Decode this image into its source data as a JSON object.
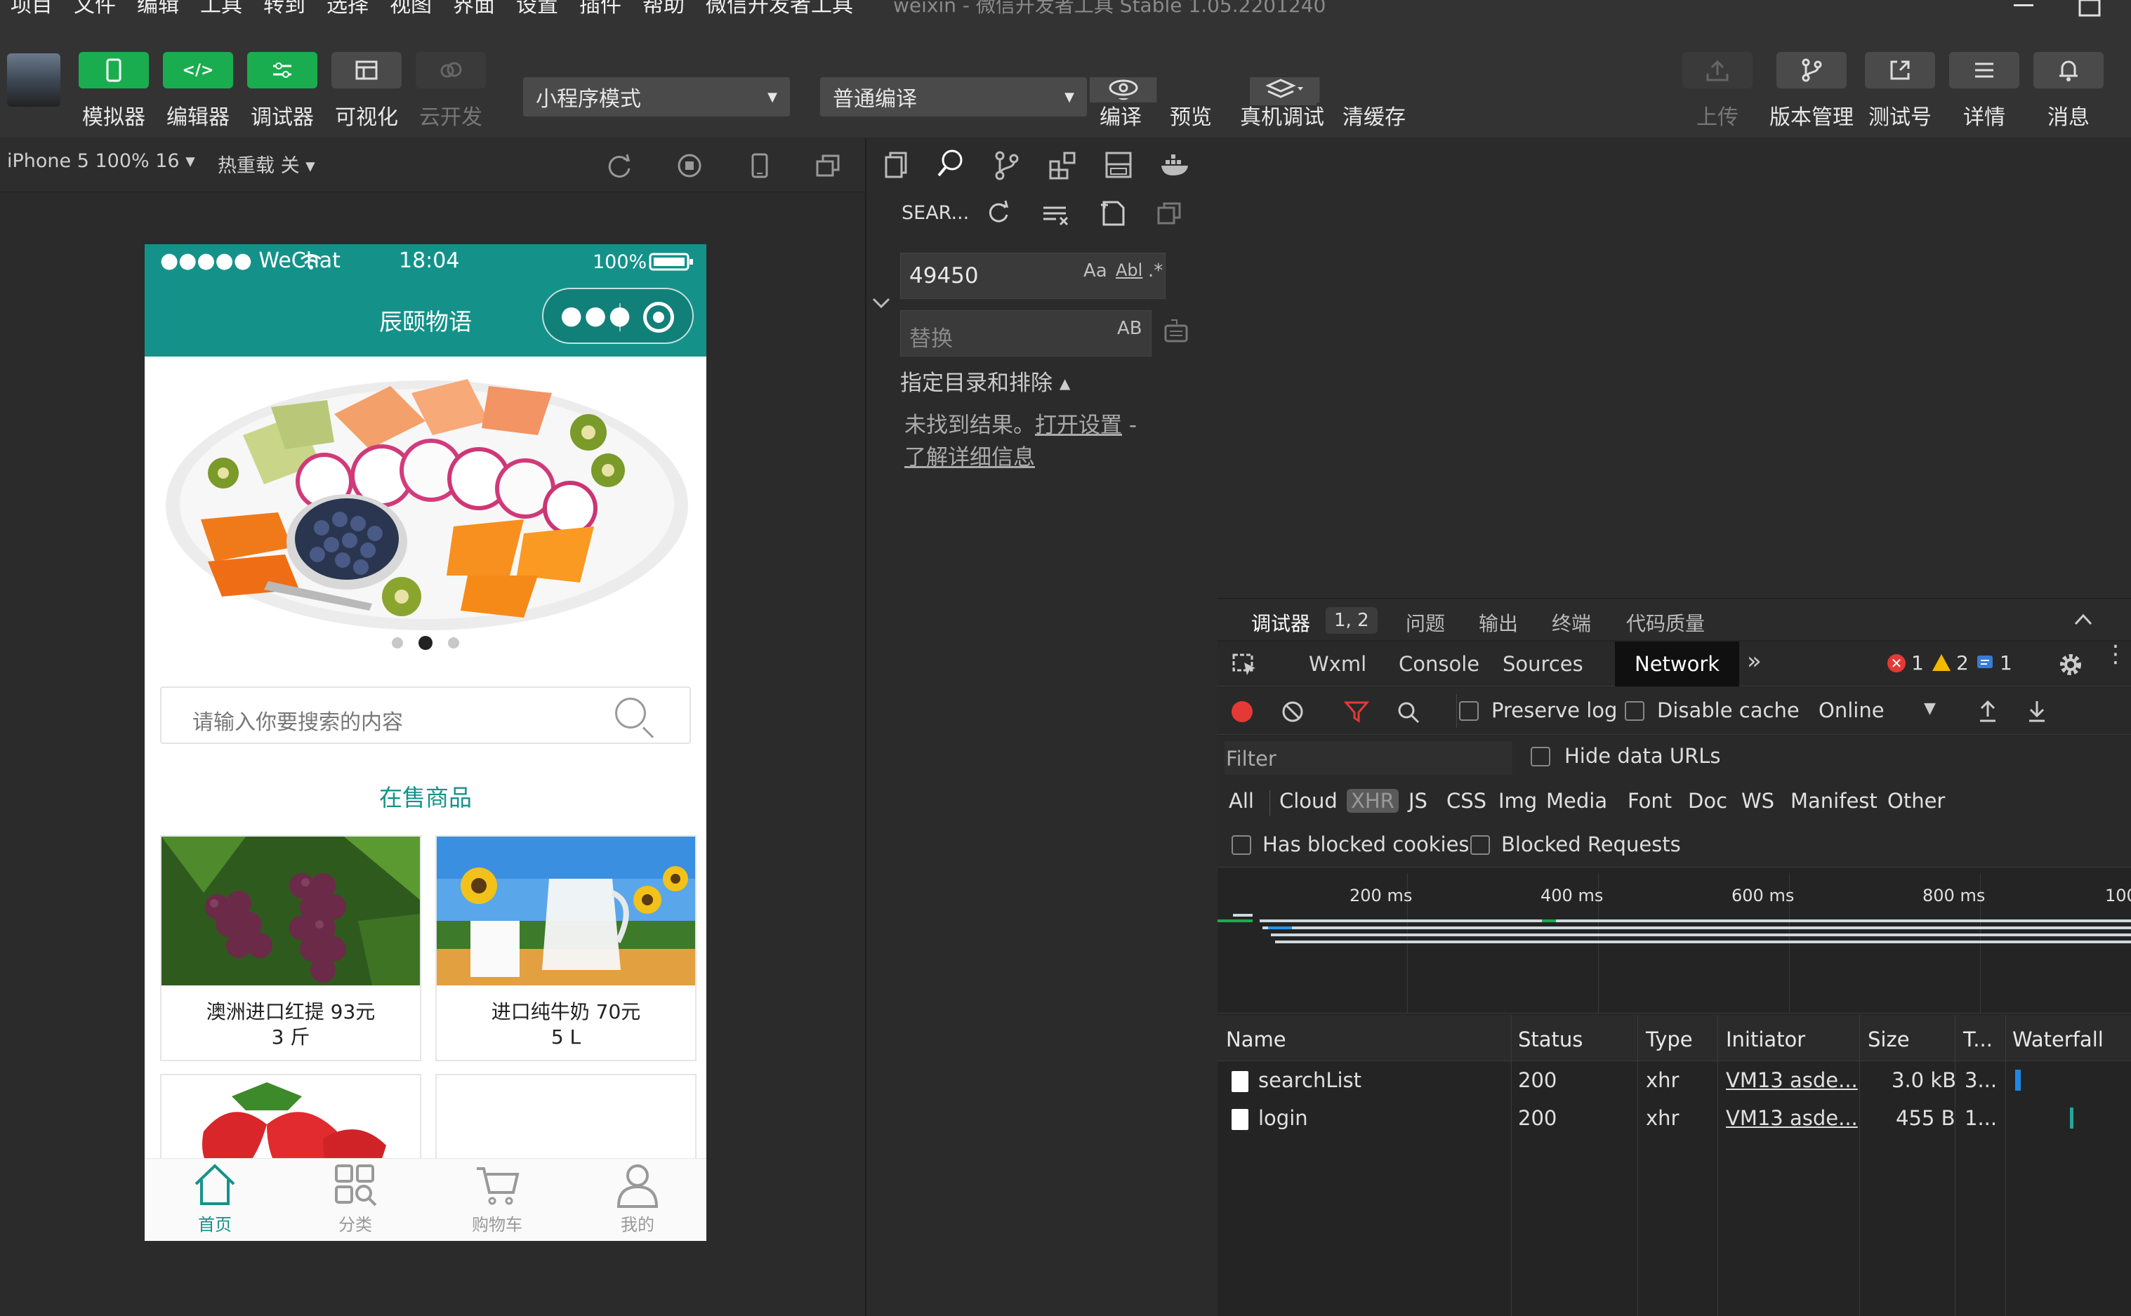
{
  "menubar": {
    "items": [
      "项目",
      "文件",
      "编辑",
      "工具",
      "转到",
      "选择",
      "视图",
      "界面",
      "设置",
      "插件",
      "帮助",
      "微信开发者工具"
    ],
    "window_title": "weixin - 微信开发者工具 Stable 1.05.2201240"
  },
  "toolbar": {
    "simulator": "模拟器",
    "editor": "编辑器",
    "debugger": "调试器",
    "visual": "可视化",
    "cloud": "云开发",
    "mode_select": "小程序模式",
    "compile_select": "普通编译",
    "compile": "编译",
    "preview": "预览",
    "remote_debug": "真机调试",
    "clear_cache": "清缓存",
    "upload": "上传",
    "version": "版本管理",
    "testnum": "测试号",
    "details": "详情",
    "messages": "消息"
  },
  "simbar": {
    "device": "iPhone 5 100% 16 ▾",
    "hotreload": "热重载 关 ▾"
  },
  "phone": {
    "status_carrier": "●●●●● WeChat",
    "status_time": "18:04",
    "status_battery": "100%",
    "nav_title": "辰颐物语",
    "search_placeholder": "请输入你要搜索的内容",
    "section_title": "在售商品",
    "products": [
      {
        "name": "澳洲进口红提 93元",
        "unit": "3 斤"
      },
      {
        "name": "进口纯牛奶 70元",
        "unit": "5 L"
      },
      {
        "name": "",
        "unit": ""
      },
      {
        "name": "",
        "unit": ""
      }
    ],
    "tabs": [
      {
        "label": "首页",
        "icon": "home-icon"
      },
      {
        "label": "分类",
        "icon": "category-icon"
      },
      {
        "label": "购物车",
        "icon": "cart-icon"
      },
      {
        "label": "我的",
        "icon": "user-icon"
      }
    ]
  },
  "explorer": {
    "search_heading": "SEAR...",
    "search_value": "49450",
    "opt_case": "Aa",
    "opt_word": "Abl",
    "opt_regex": ".*",
    "replace_placeholder": "替换",
    "replace_opt": "AB",
    "include_exclude": "指定目录和排除 ▴",
    "no_results": "未找到结果。",
    "open_settings": "打开设置",
    "dash": " -",
    "learn_more": "了解详细信息"
  },
  "devtools": {
    "tabs": [
      "调试器",
      "问题",
      "输出",
      "终端",
      "代码质量"
    ],
    "badge": "1, 2",
    "panels": [
      "Wxml",
      "Console",
      "Sources",
      "Network"
    ],
    "errors": "1",
    "warnings": "2",
    "infos": "1",
    "preserve_log": "Preserve log",
    "disable_cache": "Disable cache",
    "throttle": "Online",
    "filter_placeholder": "Filter",
    "hide_data_urls": "Hide data URLs",
    "types": [
      "All",
      "Cloud",
      "XHR",
      "JS",
      "CSS",
      "Img",
      "Media",
      "Font",
      "Doc",
      "WS",
      "Manifest",
      "Other"
    ],
    "selected_type": "XHR",
    "has_blocked": "Has blocked cookies",
    "blocked_requests": "Blocked Requests",
    "ticks": [
      "200 ms",
      "400 ms",
      "600 ms",
      "800 ms",
      "100"
    ],
    "columns": [
      "Name",
      "Status",
      "Type",
      "Initiator",
      "Size",
      "T...",
      "Waterfall"
    ],
    "rows": [
      {
        "name": "searchList",
        "status": "200",
        "type": "xhr",
        "initiator": "VM13 asde...",
        "size": "3.0 kB",
        "time": "3..."
      },
      {
        "name": "login",
        "status": "200",
        "type": "xhr",
        "initiator": "VM13 asde...",
        "size": "455 B",
        "time": "1..."
      }
    ]
  },
  "colors": {
    "brand_green": "#1aad4f",
    "teal": "#14928a",
    "error": "#e53935",
    "warning": "#f5b800",
    "info": "#3a7bd5"
  }
}
